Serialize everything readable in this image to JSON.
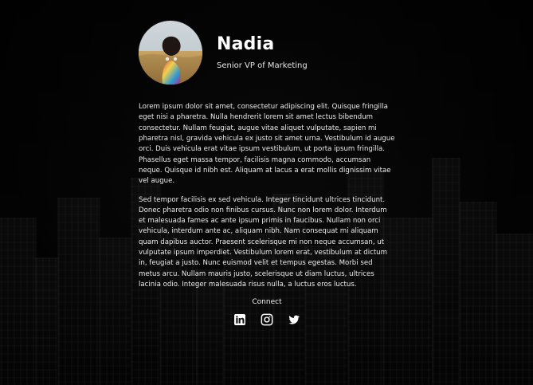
{
  "profile": {
    "name": "Nadia",
    "title": "Senior VP of Marketing"
  },
  "bio": {
    "paragraphs": [
      "Lorem ipsum dolor sit amet, consectetur adipiscing elit. Quisque fringilla eget nisi a pharetra. Nulla hendrerit lorem sit amet lectus bibendum consectetur. Nullam feugiat, augue vitae aliquet vulputate, sapien mi pharetra nisl, gravida vehicula ex justo sit amet urna. Vestibulum id augue orci. Duis vehicula erat vitae ipsum vestibulum, ut porta ipsum fringilla. Phasellus eget massa tempor, facilisis magna commodo, accumsan neque. Quisque id nibh est. Aliquam at lacus a erat mollis dignissim vitae vel augue.",
      "Sed tempor facilisis ex sed vehicula. Integer tincidunt ultrices tincidunt. Donec pharetra odio non finibus cursus. Nunc non lorem dolor. Interdum et malesuada fames ac ante ipsum primis in faucibus. Nullam non orci vehicula, interdum ante ac, aliquam nibh. Nam consequat mi aliquam quam dapibus auctor. Praesent scelerisque mi non neque accumsan, ut vulputate ipsum imperdiet. Vestibulum lorem erat, vestibulum at dictum in, feugiat a justo. Nunc euismod velit et tempus egestas. Morbi sed metus arcu. Nullam mauris justo, scelerisque ut diam luctus, ultrices lacinia odio. Integer malesuada risus nulla, a luctus eros luctus."
    ]
  },
  "connect": {
    "label": "Connect",
    "icons": [
      {
        "name": "linkedin-icon"
      },
      {
        "name": "instagram-icon"
      },
      {
        "name": "twitter-icon"
      }
    ]
  }
}
